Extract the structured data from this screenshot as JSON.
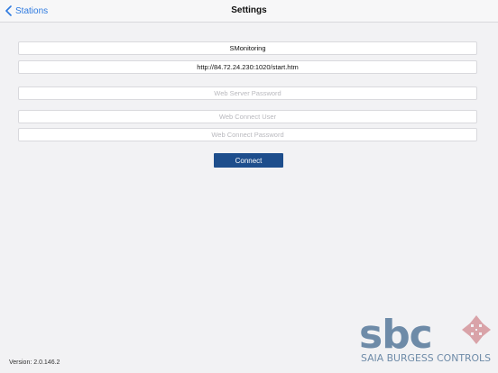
{
  "nav": {
    "back_label": "Stations",
    "title": "Settings"
  },
  "form": {
    "station_name_value": "SMonitoring",
    "url_value": "http://84.72.24.230:1020/start.htm",
    "web_server_password_placeholder": "Web Server Password",
    "web_connect_user_placeholder": "Web Connect User",
    "web_connect_password_placeholder": "Web Connect Password",
    "connect_label": "Connect"
  },
  "footer": {
    "version": "Version: 2.0.146.2",
    "logo_text": "sbc",
    "logo_tagline": "SAIA BURGESS CONTROLS"
  },
  "colors": {
    "accent": "#2f7be0",
    "button": "#1e4e8c",
    "logo_blue": "#6e8ba8",
    "logo_red": "#d9a3a8"
  },
  "icons": {
    "back": "chevron-left-icon",
    "logo_mark": "sbc-cross-arrows-icon"
  }
}
